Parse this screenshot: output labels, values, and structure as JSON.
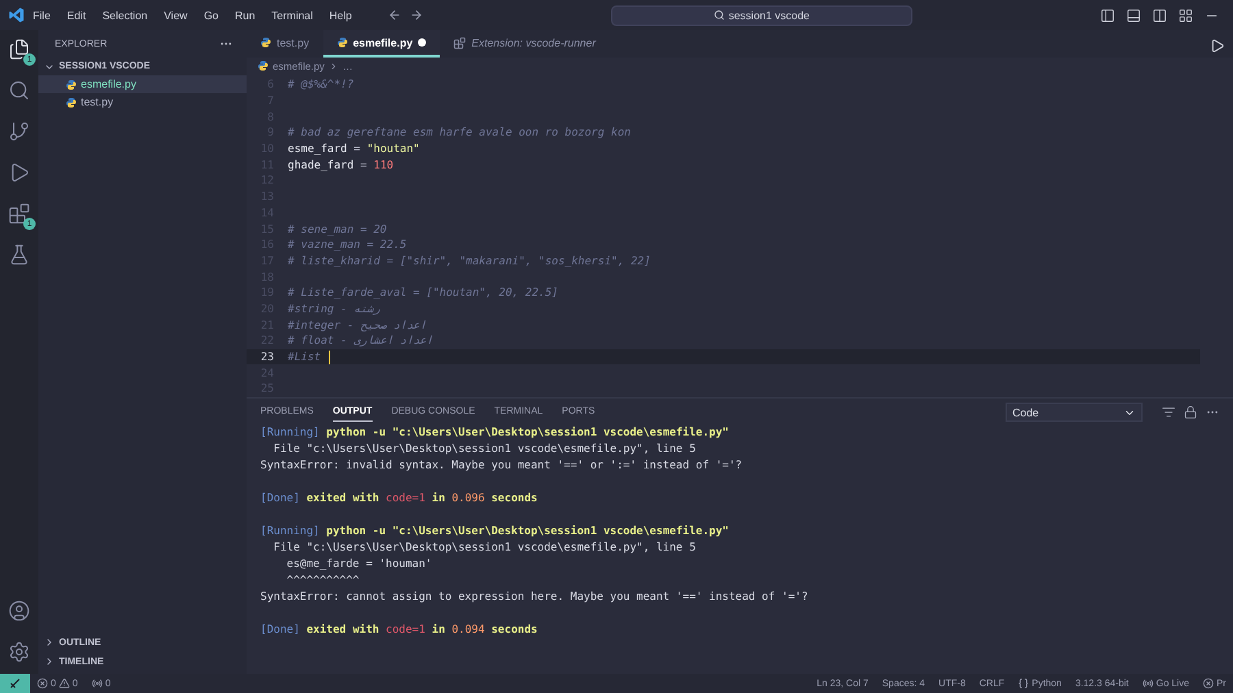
{
  "menu": [
    "File",
    "Edit",
    "Selection",
    "View",
    "Go",
    "Run",
    "Terminal",
    "Help"
  ],
  "search": {
    "value": "session1 vscode"
  },
  "activity_badges": {
    "explorer": "1",
    "extensions": "1"
  },
  "sidebar": {
    "title": "EXPLORER",
    "folder": {
      "label": "SESSION1 VSCODE",
      "expanded": true,
      "files": [
        {
          "label": "esmefile.py",
          "selected": true
        },
        {
          "label": "test.py",
          "selected": false
        }
      ]
    },
    "sections": [
      {
        "label": "OUTLINE",
        "expanded": false
      },
      {
        "label": "TIMELINE",
        "expanded": false
      }
    ]
  },
  "tabs": [
    {
      "label": "test.py",
      "kind": "python",
      "selected": false,
      "modified": false
    },
    {
      "label": "esmefile.py",
      "kind": "python",
      "selected": true,
      "modified": true
    },
    {
      "label": "Extension: vscode-runner",
      "kind": "extension",
      "selected": false,
      "modified": false
    }
  ],
  "breadcrumb": [
    "esmefile.py",
    "…"
  ],
  "editor": {
    "lines": [
      {
        "number": "6",
        "current": false,
        "tokens": [
          {
            "kind": "comment",
            "text": "# @$%&^*!?"
          }
        ]
      },
      {
        "number": "7",
        "current": false
      },
      {
        "number": "8",
        "current": false
      },
      {
        "number": "9",
        "current": false,
        "tokens": [
          {
            "kind": "comment",
            "text": "# bad az gereftane esm harfe avale oon ro bozorg kon"
          }
        ]
      },
      {
        "number": "10",
        "current": false,
        "tokens": [
          {
            "kind": "var",
            "text": "esme_fard"
          },
          {
            "kind": "op",
            "text": " = "
          },
          {
            "kind": "string",
            "text": "\"houtan\""
          }
        ]
      },
      {
        "number": "11",
        "current": false,
        "tokens": [
          {
            "kind": "var",
            "text": "ghade_fard"
          },
          {
            "kind": "op",
            "text": " = "
          },
          {
            "kind": "number",
            "text": "110"
          }
        ]
      },
      {
        "number": "12",
        "current": false
      },
      {
        "number": "13",
        "current": false
      },
      {
        "number": "14",
        "current": false
      },
      {
        "number": "15",
        "current": false,
        "tokens": [
          {
            "kind": "comment",
            "text": "# sene_man = 20"
          }
        ]
      },
      {
        "number": "16",
        "current": false,
        "tokens": [
          {
            "kind": "comment",
            "text": "# vazne_man = 22.5"
          }
        ]
      },
      {
        "number": "17",
        "current": false,
        "tokens": [
          {
            "kind": "comment",
            "text": "# liste_kharid = [\"shir\", \"makarani\", \"sos_khersi\", 22]"
          }
        ]
      },
      {
        "number": "18",
        "current": false
      },
      {
        "number": "19",
        "current": false,
        "tokens": [
          {
            "kind": "comment",
            "text": "# Liste_farde_aval = [\"houtan\", 20, 22.5]"
          }
        ]
      },
      {
        "number": "20",
        "current": false,
        "tokens": [
          {
            "kind": "comment",
            "text": "#string - رشته"
          }
        ]
      },
      {
        "number": "21",
        "current": false,
        "tokens": [
          {
            "kind": "comment",
            "text": "#integer - اعداد صحیح"
          }
        ]
      },
      {
        "number": "22",
        "current": false,
        "tokens": [
          {
            "kind": "comment",
            "text": "# float - اعداد اعشاری"
          }
        ]
      },
      {
        "number": "23",
        "current": true,
        "tokens": [
          {
            "kind": "comment",
            "text": "#List "
          }
        ]
      },
      {
        "number": "24",
        "current": false
      },
      {
        "number": "25",
        "current": false
      }
    ]
  },
  "panel": {
    "tabs": [
      {
        "label": "PROBLEMS",
        "selected": false
      },
      {
        "label": "OUTPUT",
        "selected": true
      },
      {
        "label": "DEBUG CONSOLE",
        "selected": false
      },
      {
        "label": "TERMINAL",
        "selected": false
      },
      {
        "label": "PORTS",
        "selected": false
      }
    ],
    "channel": "Code",
    "output_blocks": [
      [
        [
          {
            "kind": "tag",
            "text": "[Running]"
          },
          {
            "kind": "cmd",
            "text": " python -u \"c:\\Users\\User\\Desktop\\session1 vscode\\esmefile.py\""
          }
        ],
        [
          {
            "kind": "plain",
            "text": "  File \"c:\\Users\\User\\Desktop\\session1 vscode\\esmefile.py\", line 5"
          }
        ],
        [
          {
            "kind": "plain",
            "text": "SyntaxError: invalid syntax. Maybe you meant '==' or ':=' instead of '='?"
          }
        ]
      ],
      [
        [
          {
            "kind": "tag",
            "text": "[Done]"
          },
          {
            "kind": "cmd",
            "text": " exited with "
          },
          {
            "kind": "code",
            "text": "code=1"
          },
          {
            "kind": "cmd",
            "text": " in "
          },
          {
            "kind": "num",
            "text": "0.096"
          },
          {
            "kind": "cmd",
            "text": " seconds"
          }
        ]
      ],
      [
        [
          {
            "kind": "tag",
            "text": "[Running]"
          },
          {
            "kind": "cmd",
            "text": " python -u \"c:\\Users\\User\\Desktop\\session1 vscode\\esmefile.py\""
          }
        ],
        [
          {
            "kind": "plain",
            "text": "  File \"c:\\Users\\User\\Desktop\\session1 vscode\\esmefile.py\", line 5"
          }
        ],
        [
          {
            "kind": "plain",
            "text": "    es@me_farde = 'houman'"
          }
        ],
        [
          {
            "kind": "plain",
            "text": "    ^^^^^^^^^^^"
          }
        ],
        [
          {
            "kind": "plain",
            "text": "SyntaxError: cannot assign to expression here. Maybe you meant '==' instead of '='?"
          }
        ]
      ],
      [
        [
          {
            "kind": "tag",
            "text": "[Done]"
          },
          {
            "kind": "cmd",
            "text": " exited with "
          },
          {
            "kind": "code",
            "text": "code=1"
          },
          {
            "kind": "cmd",
            "text": " in "
          },
          {
            "kind": "num",
            "text": "0.094"
          },
          {
            "kind": "cmd",
            "text": " seconds"
          }
        ]
      ]
    ]
  },
  "status": {
    "errors": "0",
    "warnings": "0",
    "ports": "0",
    "right": [
      {
        "kind": "text",
        "text": "Ln 23, Col 7"
      },
      {
        "kind": "text",
        "text": "Spaces: 4"
      },
      {
        "kind": "text",
        "text": "UTF-8"
      },
      {
        "kind": "text",
        "text": "CRLF"
      },
      {
        "kind": "language",
        "text": "Python"
      },
      {
        "kind": "text",
        "text": "3.12.3 64-bit"
      },
      {
        "kind": "live",
        "text": "Go Live"
      },
      {
        "kind": "prettier",
        "text": "Pr"
      }
    ]
  }
}
